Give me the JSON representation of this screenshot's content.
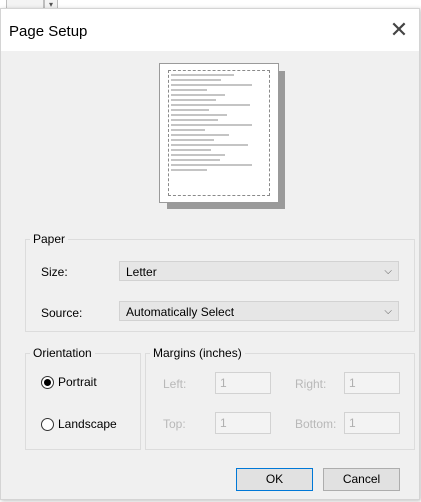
{
  "dialog": {
    "title": "Page Setup",
    "close_icon": "close-icon"
  },
  "paper": {
    "legend": "Paper",
    "size_label": "Size:",
    "size_value": "Letter",
    "source_label": "Source:",
    "source_value": "Automatically Select"
  },
  "orientation": {
    "legend": "Orientation",
    "portrait_label": "Portrait",
    "landscape_label": "Landscape",
    "selected": "Portrait"
  },
  "margins": {
    "legend": "Margins (inches)",
    "left_label": "Left:",
    "left_value": "1",
    "right_label": "Right:",
    "right_value": "1",
    "top_label": "Top:",
    "top_value": "1",
    "bottom_label": "Bottom:",
    "bottom_value": "1"
  },
  "buttons": {
    "ok_label": "OK",
    "cancel_label": "Cancel"
  }
}
